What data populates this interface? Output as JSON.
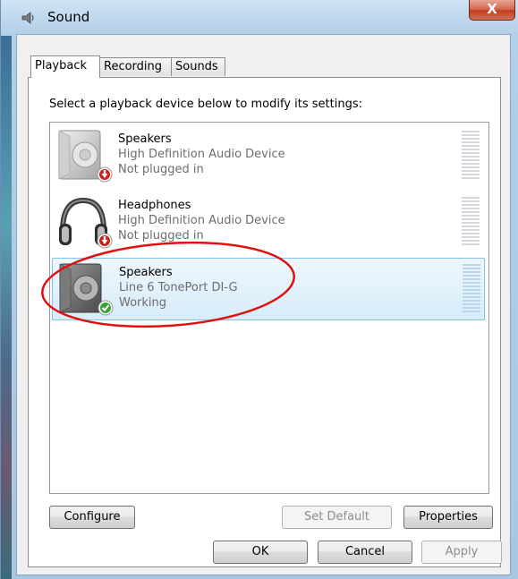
{
  "window": {
    "title": "Sound",
    "close_glyph": "X",
    "accent": "#c23f20"
  },
  "tabs": [
    {
      "label": "Playback",
      "active": true
    },
    {
      "label": "Recording",
      "active": false
    },
    {
      "label": "Sounds",
      "active": false
    }
  ],
  "playback": {
    "instruction": "Select a playback device below to modify its settings:",
    "devices": [
      {
        "name": "Speakers",
        "driver": "High Definition Audio Device",
        "status": "Not plugged in",
        "icon": "speaker-icon",
        "badge": "red-down-arrow-icon",
        "selected": false
      },
      {
        "name": "Headphones",
        "driver": "High Definition Audio Device",
        "status": "Not plugged in",
        "icon": "headphones-icon",
        "badge": "red-down-arrow-icon",
        "selected": false
      },
      {
        "name": "Speakers",
        "driver": "Line 6 TonePort DI-G",
        "status": "Working",
        "icon": "speaker-icon",
        "badge": "green-check-icon",
        "selected": true
      }
    ],
    "buttons": {
      "configure": "Configure",
      "set_default": "Set Default",
      "properties": "Properties"
    }
  },
  "dialog_buttons": {
    "ok": "OK",
    "cancel": "Cancel",
    "apply": "Apply"
  },
  "annotation_color": "#e01010"
}
